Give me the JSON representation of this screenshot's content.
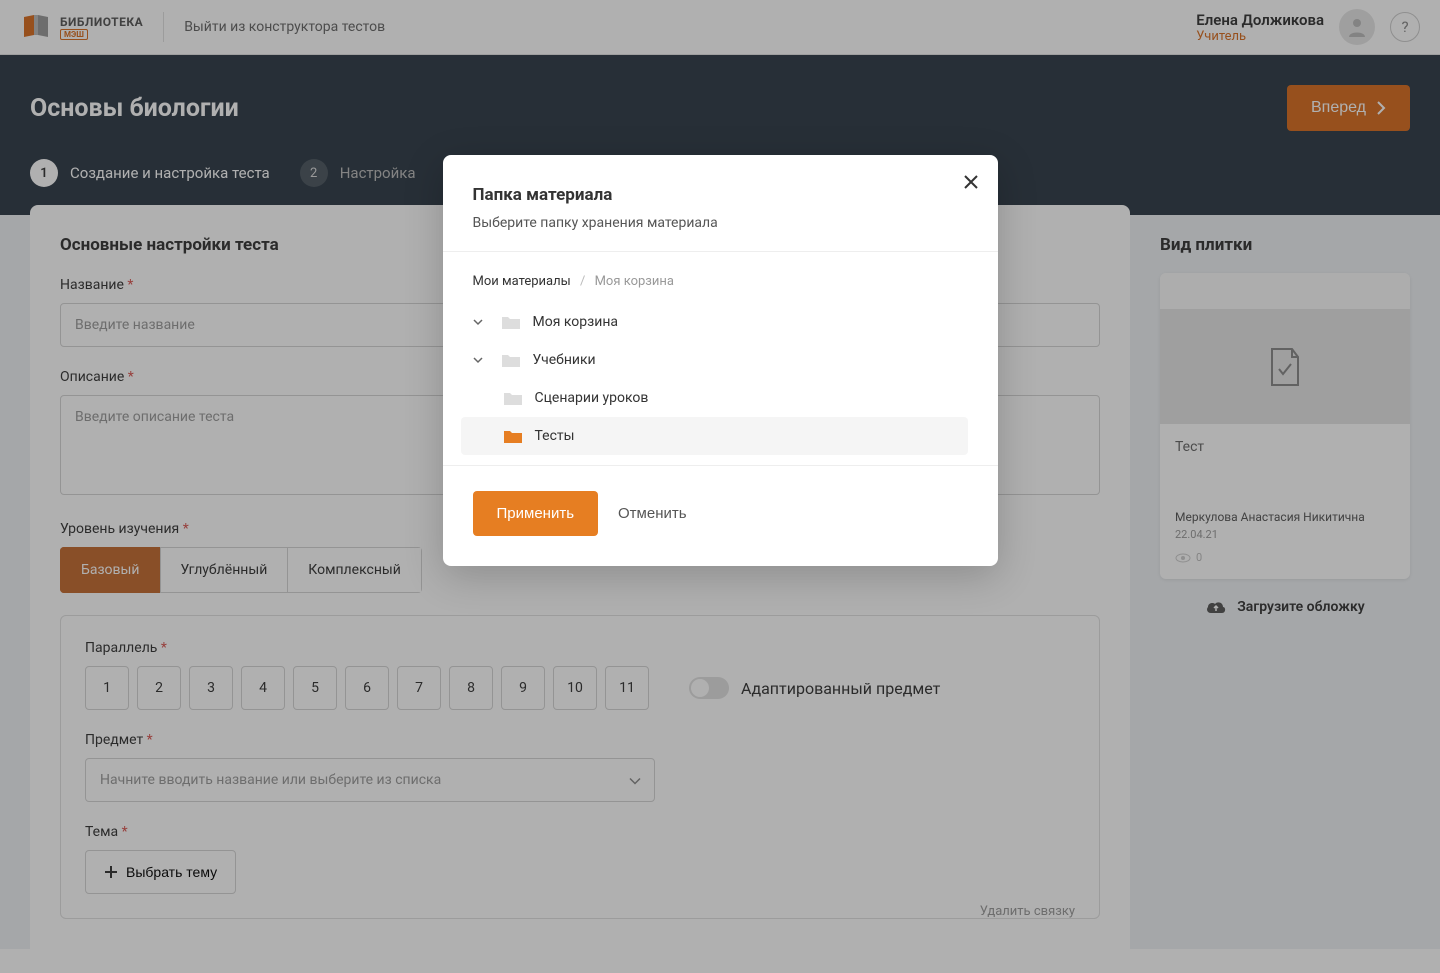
{
  "topbar": {
    "brand_title": "БИБЛИОТЕКА",
    "brand_sub": "МЭШ",
    "exit_label": "Выйти из конструктора тестов",
    "user_name": "Елена Должикова",
    "user_role": "Учитель",
    "help_label": "?"
  },
  "hero": {
    "title": "Основы биологии",
    "forward_label": "Вперед",
    "steps": [
      {
        "num": "1",
        "label": "Создание и настройка теста"
      },
      {
        "num": "2",
        "label": "Настройка"
      }
    ]
  },
  "form": {
    "section_title": "Основные настройки теста",
    "name_label": "Название",
    "name_placeholder": "Введите название",
    "desc_label": "Описание",
    "desc_placeholder": "Введите описание теста",
    "level_label": "Уровень изучения",
    "levels": [
      "Базовый",
      "Углублённый",
      "Комплексный"
    ],
    "parallel_label": "Параллель",
    "parallels": [
      "1",
      "2",
      "3",
      "4",
      "5",
      "6",
      "7",
      "8",
      "9",
      "10",
      "11"
    ],
    "adapted_label": "Адаптированный предмет",
    "subject_label": "Предмет",
    "subject_placeholder": "Начните вводить название или выберите из списка",
    "topic_label": "Тема",
    "topic_button": "Выбрать тему",
    "delete_link": "Удалить связку"
  },
  "sidebar": {
    "title": "Вид плитки",
    "tile_type": "Тест",
    "tile_author": "Меркулова Анастасия Никитична",
    "tile_date": "22.04.21",
    "tile_views": "0",
    "upload_label": "Загрузите обложку"
  },
  "modal": {
    "title": "Папка материала",
    "subtitle": "Выберите папку хранения материала",
    "breadcrumb_root": "Мои материалы",
    "breadcrumb_current": "Моя корзина",
    "folders": [
      {
        "label": "Моя корзина",
        "expandable": true,
        "indent": 0
      },
      {
        "label": "Учебники",
        "expandable": true,
        "indent": 0
      },
      {
        "label": "Сценарии уроков",
        "expandable": false,
        "indent": 1
      },
      {
        "label": "Тесты",
        "expandable": false,
        "indent": 1,
        "selected": true
      }
    ],
    "apply_label": "Применить",
    "cancel_label": "Отменить"
  }
}
